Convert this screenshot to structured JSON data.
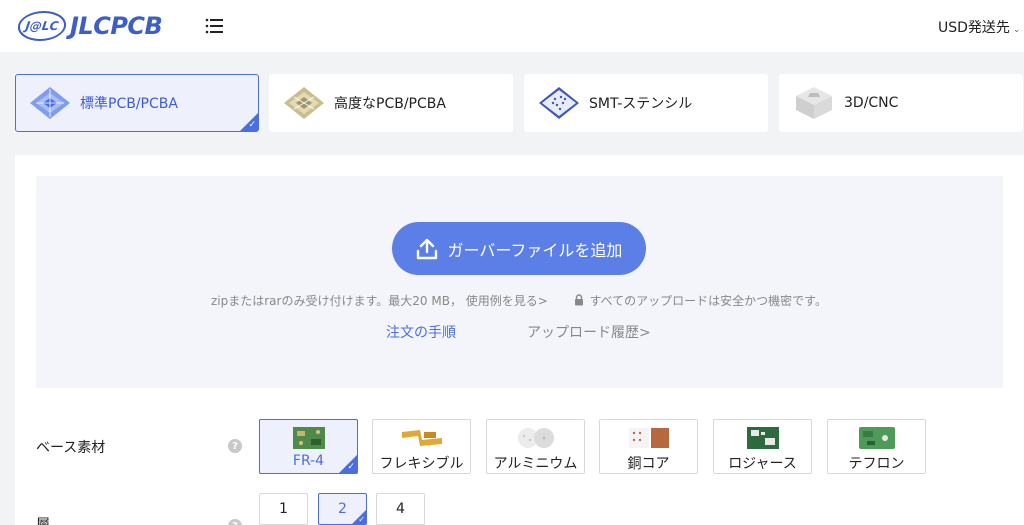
{
  "header": {
    "logo_mark": "J@LC",
    "logo_text": "JLCPCB",
    "menu_icon": "hamburger-icon",
    "currency": "USD発送先"
  },
  "product_tabs": [
    {
      "label": "標準PCB/PCBA",
      "icon": "standard-pcb-icon",
      "active": true
    },
    {
      "label": "高度なPCB/PCBA",
      "icon": "advanced-pcb-icon",
      "active": false
    },
    {
      "label": "SMT-ステンシル",
      "icon": "smt-stencil-icon",
      "active": false
    },
    {
      "label": "3D/CNC",
      "icon": "3d-cnc-icon",
      "active": false
    }
  ],
  "upload": {
    "button_label": "ガーバーファイルを追加",
    "info_text": "zipまたはrarのみ受け付けます。最大20 MB，",
    "example_link": "使用例を見る>",
    "security_text": "すべてのアップロードは安全かつ機密です。",
    "order_steps": "注文の手順",
    "history_link": "アップロード履歴>"
  },
  "options": {
    "base_material_label": "ベース素材",
    "layers_label": "層",
    "materials": [
      {
        "label": "FR-4",
        "active": true
      },
      {
        "label": "フレキシブル",
        "active": false
      },
      {
        "label": "アルミニウム",
        "active": false
      },
      {
        "label": "銅コア",
        "active": false
      },
      {
        "label": "ロジャース",
        "active": false
      },
      {
        "label": "テフロン",
        "active": false
      }
    ],
    "layers": [
      {
        "label": "1",
        "active": false
      },
      {
        "label": "2",
        "active": true
      },
      {
        "label": "4",
        "active": false
      }
    ]
  },
  "colors": {
    "brand": "#3d5fc5",
    "accent": "#4a6ee0",
    "upload_button": "#5b7fe6"
  }
}
